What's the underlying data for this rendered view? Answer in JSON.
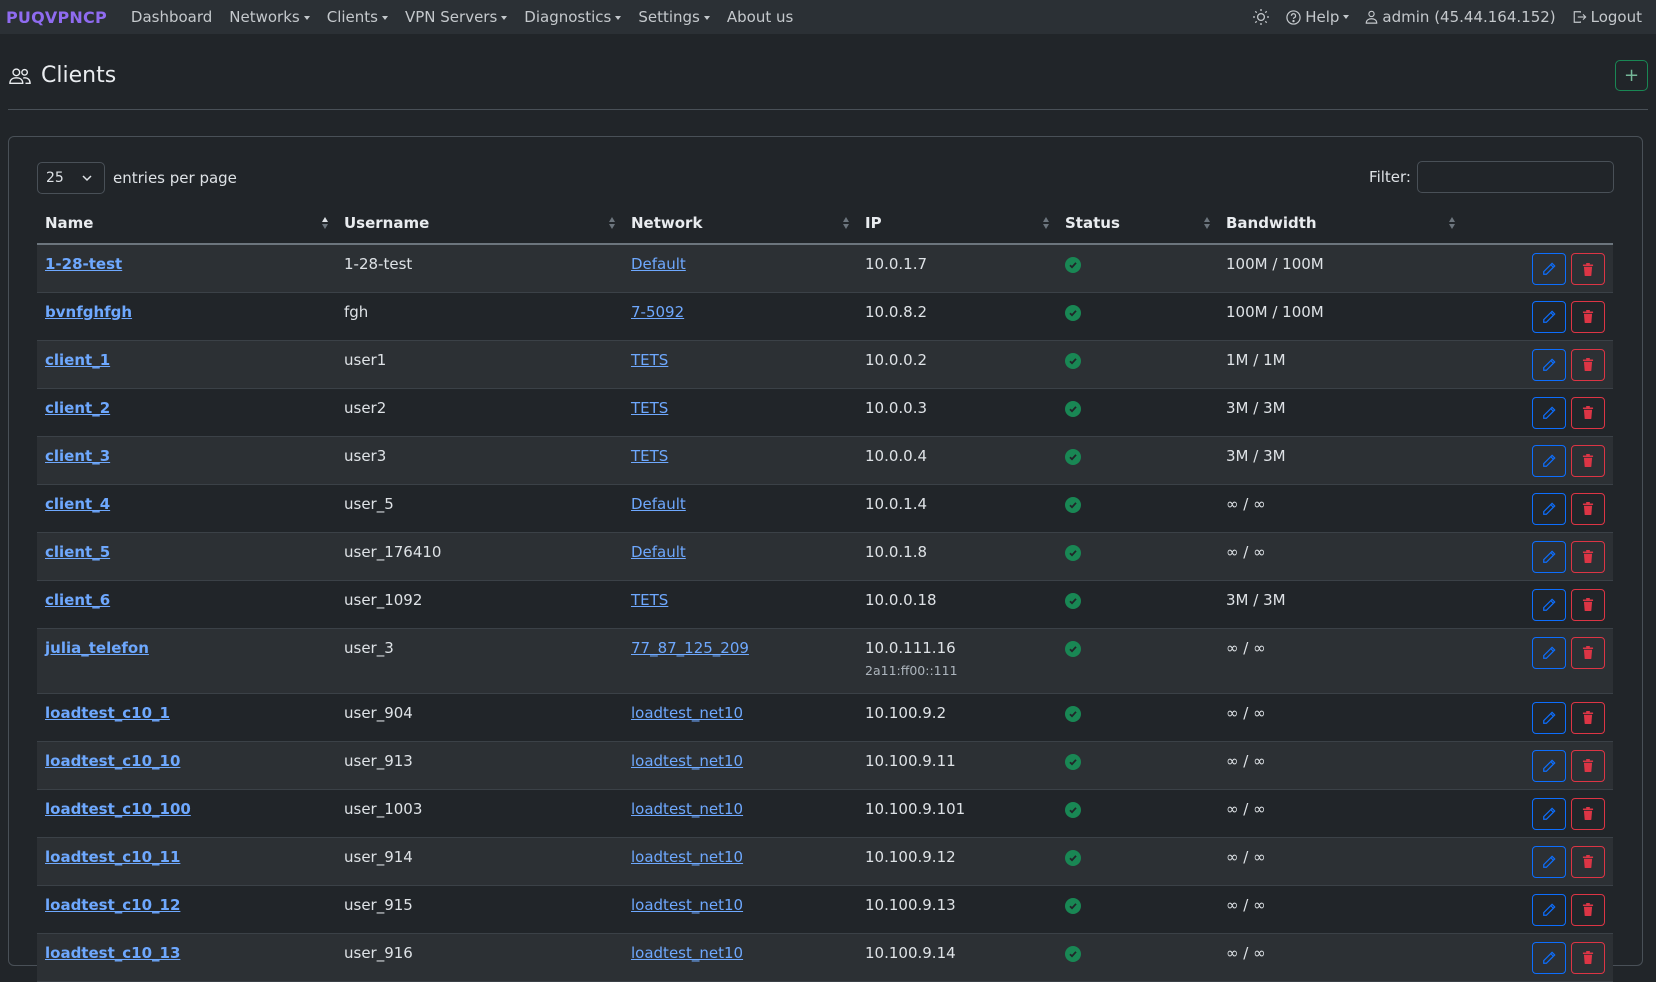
{
  "navbar": {
    "brand": "PUQVPNCP",
    "items": [
      {
        "label": "Dashboard",
        "dropdown": false
      },
      {
        "label": "Networks",
        "dropdown": true
      },
      {
        "label": "Clients",
        "dropdown": true
      },
      {
        "label": "VPN Servers",
        "dropdown": true
      },
      {
        "label": "Diagnostics",
        "dropdown": true
      },
      {
        "label": "Settings",
        "dropdown": true
      },
      {
        "label": "About us",
        "dropdown": false
      }
    ],
    "help_label": "Help",
    "user_label": "admin (45.44.164.152)",
    "logout_label": "Logout"
  },
  "page": {
    "title": "Clients",
    "add_button_glyph": "+"
  },
  "controls": {
    "per_page_value": "25",
    "per_page_label": "entries per page",
    "filter_label": "Filter:",
    "filter_value": ""
  },
  "table": {
    "columns": [
      "Name",
      "Username",
      "Network",
      "IP",
      "Status",
      "Bandwidth"
    ],
    "sorted_column": "Name",
    "rows": [
      {
        "name": "1-28-test",
        "username": "1-28-test",
        "network": "Default",
        "ip": "10.0.1.7",
        "ipv6": "",
        "status": "active",
        "bandwidth": "100M / 100M"
      },
      {
        "name": "bvnfghfgh",
        "username": "fgh",
        "network": "7-5092",
        "ip": "10.0.8.2",
        "ipv6": "",
        "status": "active",
        "bandwidth": "100M / 100M"
      },
      {
        "name": "client_1",
        "username": "user1",
        "network": "TETS",
        "ip": "10.0.0.2",
        "ipv6": "",
        "status": "active",
        "bandwidth": "1M / 1M"
      },
      {
        "name": "client_2",
        "username": "user2",
        "network": "TETS",
        "ip": "10.0.0.3",
        "ipv6": "",
        "status": "active",
        "bandwidth": "3M / 3M"
      },
      {
        "name": "client_3",
        "username": "user3",
        "network": "TETS",
        "ip": "10.0.0.4",
        "ipv6": "",
        "status": "active",
        "bandwidth": "3M / 3M"
      },
      {
        "name": "client_4",
        "username": "user_5",
        "network": "Default",
        "ip": "10.0.1.4",
        "ipv6": "",
        "status": "active",
        "bandwidth": "∞ / ∞"
      },
      {
        "name": "client_5",
        "username": "user_176410",
        "network": "Default",
        "ip": "10.0.1.8",
        "ipv6": "",
        "status": "active",
        "bandwidth": "∞ / ∞"
      },
      {
        "name": "client_6",
        "username": "user_1092",
        "network": "TETS",
        "ip": "10.0.0.18",
        "ipv6": "",
        "status": "active",
        "bandwidth": "3M / 3M"
      },
      {
        "name": "julia_telefon",
        "username": "user_3",
        "network": "77_87_125_209",
        "ip": "10.0.111.16",
        "ipv6": "2a11:ff00::111",
        "status": "active",
        "bandwidth": "∞ / ∞"
      },
      {
        "name": "loadtest_c10_1",
        "username": "user_904",
        "network": "loadtest_net10",
        "ip": "10.100.9.2",
        "ipv6": "",
        "status": "active",
        "bandwidth": "∞ / ∞"
      },
      {
        "name": "loadtest_c10_10",
        "username": "user_913",
        "network": "loadtest_net10",
        "ip": "10.100.9.11",
        "ipv6": "",
        "status": "active",
        "bandwidth": "∞ / ∞"
      },
      {
        "name": "loadtest_c10_100",
        "username": "user_1003",
        "network": "loadtest_net10",
        "ip": "10.100.9.101",
        "ipv6": "",
        "status": "active",
        "bandwidth": "∞ / ∞"
      },
      {
        "name": "loadtest_c10_11",
        "username": "user_914",
        "network": "loadtest_net10",
        "ip": "10.100.9.12",
        "ipv6": "",
        "status": "active",
        "bandwidth": "∞ / ∞"
      },
      {
        "name": "loadtest_c10_12",
        "username": "user_915",
        "network": "loadtest_net10",
        "ip": "10.100.9.13",
        "ipv6": "",
        "status": "active",
        "bandwidth": "∞ / ∞"
      },
      {
        "name": "loadtest_c10_13",
        "username": "user_916",
        "network": "loadtest_net10",
        "ip": "10.100.9.14",
        "ipv6": "",
        "status": "active",
        "bandwidth": "∞ / ∞"
      }
    ]
  },
  "colors": {
    "background": "#212529",
    "navbar": "#2b3035",
    "brand": "#8f6bf0",
    "link": "#6ea8fe",
    "success": "#198754",
    "primary": "#0d6efd",
    "danger": "#dc3545"
  },
  "icons": {
    "clients": "people-icon",
    "theme": "sun-icon",
    "help": "question-circle-icon",
    "user": "person-icon",
    "logout": "box-arrow-right-icon",
    "status": "check-circle-icon",
    "edit": "pencil-icon",
    "delete": "trash-icon"
  }
}
